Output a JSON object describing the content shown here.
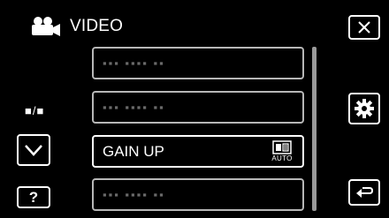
{
  "header": {
    "title": "VIDEO",
    "icon": "video-camera-icon"
  },
  "page_indicator": "■/■",
  "menu": {
    "items": [
      {
        "label": "▪▪▪ ▪▪▪▪ ▪▪",
        "state": "obscured"
      },
      {
        "label": "▪▪▪ ▪▪▪▪ ▪▪",
        "state": "obscured"
      },
      {
        "label": "GAIN UP",
        "value_icon": "auto-gain-icon",
        "value_text": "AUTO",
        "state": "highlighted"
      },
      {
        "label": "▪▪▪ ▪▪▪▪ ▪▪",
        "state": "obscured"
      }
    ]
  },
  "buttons": {
    "help_label": "?",
    "close_icon": "close-icon",
    "settings_icon": "gear-icon",
    "back_icon": "return-icon",
    "scroll_down_icon": "chevron-down-icon"
  },
  "colors": {
    "background": "#000000",
    "border": "#ffffff",
    "text": "#ffffff",
    "obscured_text": "#6a6a6a"
  }
}
